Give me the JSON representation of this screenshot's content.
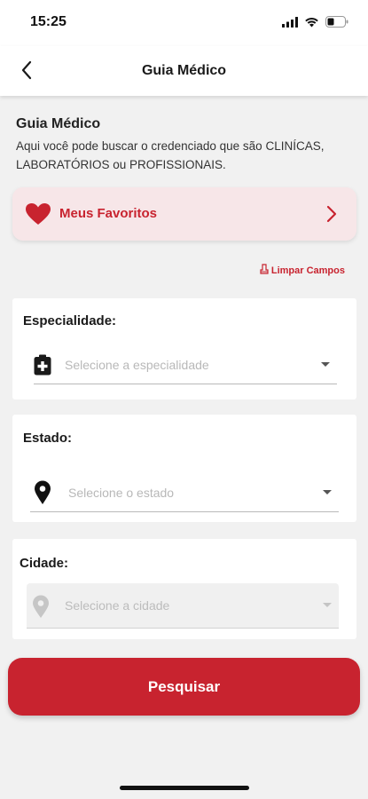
{
  "status_bar": {
    "time": "15:25",
    "icons": [
      "signal-icon",
      "wifi-icon",
      "battery-icon"
    ]
  },
  "header": {
    "title": "Guia Médico",
    "back_icon": "chevron-left-icon"
  },
  "intro": {
    "title": "Guia Médico",
    "description": "Aqui você pode buscar o credenciado que são CLINÍCAS, LABORATÓRIOS ou PROFISSIONAIS."
  },
  "favorites": {
    "label": "Meus Favoritos",
    "icon": "heart-icon"
  },
  "clear_fields": {
    "label": "Limpar Campos",
    "icon": "eraser-icon"
  },
  "fields": {
    "specialty": {
      "label": "Especialidade:",
      "placeholder": "Selecione a especialidade",
      "icon": "medical-kit-icon"
    },
    "state": {
      "label": "Estado:",
      "placeholder": "Selecione o estado",
      "icon": "location-pin-icon"
    },
    "city": {
      "label": "Cidade:",
      "placeholder": "Selecione a cidade",
      "icon": "location-pin-icon",
      "disabled": true
    }
  },
  "search_button": {
    "label": "Pesquisar"
  },
  "colors": {
    "primary": "#c8232f",
    "favorites_bg": "#f7e6e8",
    "page_bg": "#f1f1f1"
  }
}
